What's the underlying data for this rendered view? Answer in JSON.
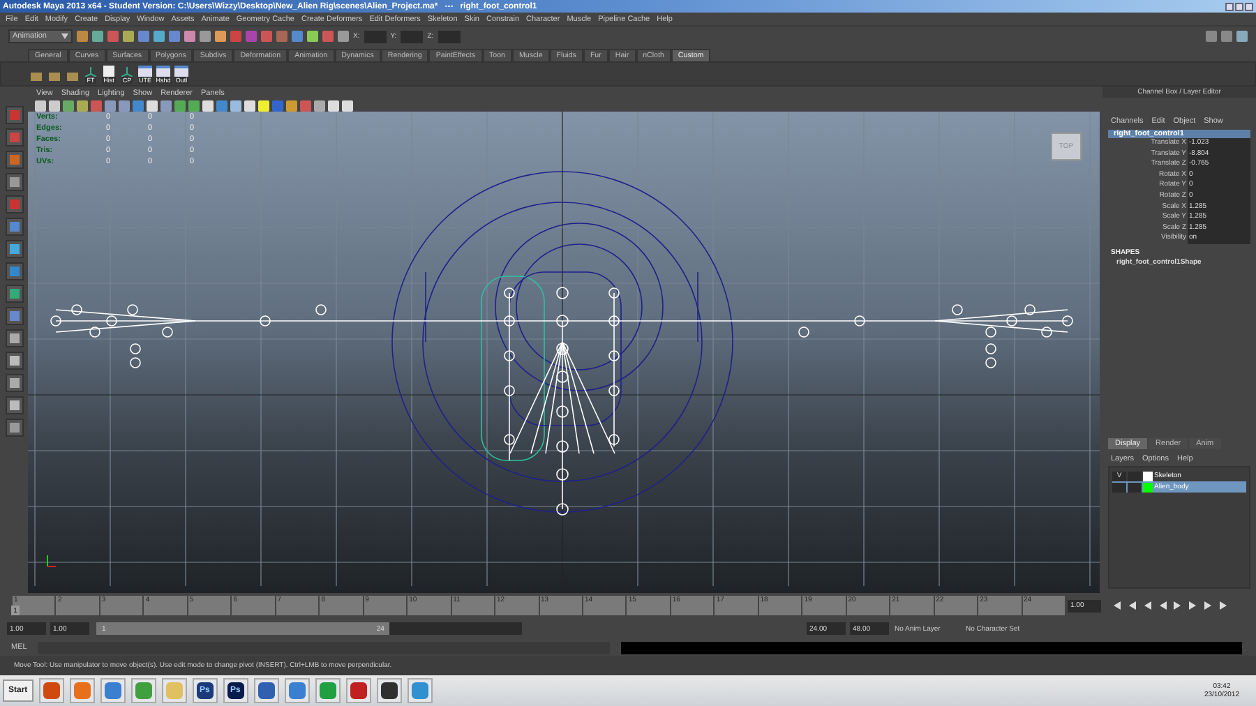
{
  "window": {
    "title": "Autodesk Maya 2013 x64 - Student Version: C:\\Users\\Wizzy\\Desktop\\New_Alien Rig\\scenes\\Alien_Project.ma*   ---   right_foot_control1"
  },
  "menus": [
    "File",
    "Edit",
    "Modify",
    "Create",
    "Display",
    "Window",
    "Assets",
    "Animate",
    "Geometry Cache",
    "Create Deformers",
    "Edit Deformers",
    "Skeleton",
    "Skin",
    "Constrain",
    "Character",
    "Muscle",
    "Pipeline Cache",
    "Help"
  ],
  "status_line": {
    "mode": "Animation",
    "coord_labels": [
      "X:",
      "Y:",
      "Z:"
    ]
  },
  "shelf_tabs": [
    {
      "label": "General",
      "selected": false
    },
    {
      "label": "Curves",
      "selected": false
    },
    {
      "label": "Surfaces",
      "selected": false
    },
    {
      "label": "Polygons",
      "selected": false
    },
    {
      "label": "Subdivs",
      "selected": false
    },
    {
      "label": "Deformation",
      "selected": false
    },
    {
      "label": "Animation",
      "selected": false
    },
    {
      "label": "Dynamics",
      "selected": false
    },
    {
      "label": "Rendering",
      "selected": false
    },
    {
      "label": "PaintEffects",
      "selected": false
    },
    {
      "label": "Toon",
      "selected": false
    },
    {
      "label": "Muscle",
      "selected": false
    },
    {
      "label": "Fluids",
      "selected": false
    },
    {
      "label": "Fur",
      "selected": false
    },
    {
      "label": "Hair",
      "selected": false
    },
    {
      "label": "nCloth",
      "selected": false
    },
    {
      "label": "Custom",
      "selected": true
    }
  ],
  "shelf_buttons": [
    {
      "kind": "icon"
    },
    {
      "kind": "icon"
    },
    {
      "kind": "icon"
    },
    {
      "kind": "joint",
      "label": "FT"
    },
    {
      "kind": "doc",
      "label": "Hist"
    },
    {
      "kind": "joint",
      "label": "CP"
    },
    {
      "kind": "window",
      "label": "UTE"
    },
    {
      "kind": "window",
      "label": "Hshd"
    },
    {
      "kind": "window",
      "label": "Outl"
    }
  ],
  "panel_menus": [
    "View",
    "Shading",
    "Lighting",
    "Show",
    "Renderer",
    "Panels"
  ],
  "hud": [
    {
      "label": "Verts:",
      "values": [
        "0",
        "0",
        "0"
      ]
    },
    {
      "label": "Edges:",
      "values": [
        "0",
        "0",
        "0"
      ]
    },
    {
      "label": "Faces:",
      "values": [
        "0",
        "0",
        "0"
      ]
    },
    {
      "label": "Tris:",
      "values": [
        "0",
        "0",
        "0"
      ]
    },
    {
      "label": "UVs:",
      "values": [
        "0",
        "0",
        "0"
      ]
    }
  ],
  "view_cube": "TOP",
  "channel_box": {
    "title": "Channel Box / Layer Editor",
    "menus": [
      "Channels",
      "Edit",
      "Object",
      "Show"
    ],
    "object": "right_foot_control1",
    "attributes": [
      {
        "name": "Translate X",
        "value": "-1.023"
      },
      {
        "name": "Translate Y",
        "value": "-8.804"
      },
      {
        "name": "Translate Z",
        "value": "-0.765"
      },
      {
        "name": "Rotate X",
        "value": "0"
      },
      {
        "name": "Rotate Y",
        "value": "0"
      },
      {
        "name": "Rotate Z",
        "value": "0"
      },
      {
        "name": "Scale X",
        "value": "1.285"
      },
      {
        "name": "Scale Y",
        "value": "1.285"
      },
      {
        "name": "Scale Z",
        "value": "1.285"
      },
      {
        "name": "Visibility",
        "value": "on"
      }
    ],
    "shapes_header": "SHAPES",
    "shape": "right_foot_control1Shape"
  },
  "layer_editor": {
    "tabs": [
      {
        "label": "Display",
        "selected": true
      },
      {
        "label": "Render",
        "selected": false
      },
      {
        "label": "Anim",
        "selected": false
      }
    ],
    "menus": [
      "Layers",
      "Options",
      "Help"
    ],
    "layers": [
      {
        "visibility": "V",
        "name": "Skeleton",
        "color": "#ffffff",
        "selected": false
      },
      {
        "name": "Alien_body",
        "color": "#00ff00",
        "selected": true
      }
    ]
  },
  "timeline": {
    "ticks": [
      "1",
      "2",
      "3",
      "4",
      "5",
      "6",
      "7",
      "8",
      "9",
      "10",
      "11",
      "12",
      "13",
      "14",
      "15",
      "16",
      "17",
      "18",
      "19",
      "20",
      "21",
      "22",
      "23",
      "24"
    ],
    "current_frame": "1",
    "current_field": "1.00",
    "level": 0
  },
  "range": {
    "start": "1.00",
    "range_start": "1.00",
    "slider_start": "1",
    "slider_end": "24",
    "level": 0.69,
    "range_end": "24.00",
    "end": "48.00",
    "anim_layer": "No Anim Layer",
    "character_set": "No Character Set"
  },
  "command_line": {
    "language": "MEL"
  },
  "help_line": "Move Tool: Use manipulator to move object(s). Use edit mode to change pivot (INSERT).  Ctrl+LMB to move perpendicular.",
  "taskbar": {
    "start": "Start",
    "apps": [
      {
        "color": "#d04a10"
      },
      {
        "color": "#e8701a"
      },
      {
        "color": "#3a7fd0"
      },
      {
        "color": "#40a040"
      },
      {
        "color": "#e0c060"
      },
      {
        "color": "#1a3a7a",
        "label": "Ps"
      },
      {
        "color": "#0a1a4a",
        "label": "Ps"
      },
      {
        "color": "#3060b0"
      },
      {
        "color": "#3a7fd0"
      },
      {
        "color": "#20a040"
      },
      {
        "color": "#c02020"
      },
      {
        "color": "#303030"
      },
      {
        "color": "#3090d0"
      }
    ],
    "time": "03:42",
    "date": "23/10/2012"
  }
}
